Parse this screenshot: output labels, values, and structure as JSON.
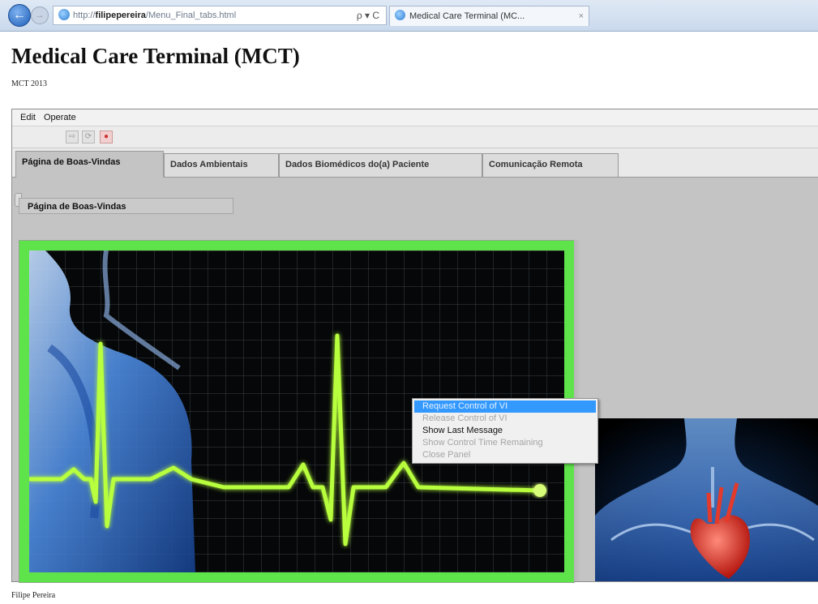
{
  "browser": {
    "address_prefix": "http://",
    "address_host": "filipepereira",
    "address_path": "/Menu_Final_tabs.html",
    "address_controls": "ρ ▾ C",
    "tab_title": "Medical Care Terminal (MC...",
    "tab_close": "×"
  },
  "page": {
    "title": "Medical Care Terminal (MCT)",
    "subtitle": "MCT 2013",
    "footer": "Filipe Pereira"
  },
  "vi": {
    "menu": [
      "Edit",
      "Operate"
    ],
    "tabs": [
      "Página de Boas-Vindas",
      "Dados Ambientais",
      "Dados Biomédicos do(a) Paciente",
      "Comunicação Remota"
    ],
    "active_tab": "Página de Boas-Vindas",
    "page_label": "Página de Boas-Vindas"
  },
  "context_menu": {
    "items": [
      {
        "label": "Request Control of VI",
        "state": "highlighted"
      },
      {
        "label": "Release Control of VI",
        "state": "disabled"
      },
      {
        "label": "Show Last Message",
        "state": "enabled"
      },
      {
        "label": "Show Control Time Remaining",
        "state": "disabled"
      },
      {
        "label": "Close Panel",
        "state": "disabled"
      }
    ]
  },
  "colors": {
    "frame_green": "#5fe34a",
    "ecg_line": "#b8ff3c",
    "body_blue": "#3f7bd6",
    "menu_highlight": "#3399ff"
  },
  "icons": [
    "back-arrow-icon",
    "forward-arrow-icon",
    "ie-icon",
    "run-icon",
    "run-continuous-icon",
    "abort-icon"
  ]
}
